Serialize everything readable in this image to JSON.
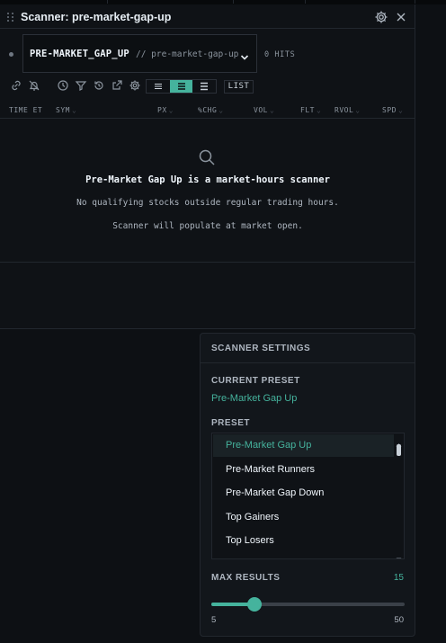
{
  "panel": {
    "title": "Scanner: pre-market-gap-up",
    "icons": {
      "settings": "gear-icon",
      "close": "close-icon",
      "drag": "grip-icon"
    }
  },
  "preset_chip": {
    "name": "PRE-MARKET_GAP_UP",
    "slug": "// pre-market-gap-up",
    "hits": "0 HITS"
  },
  "toolbar": {
    "icons": [
      "link-icon",
      "bell-off-icon",
      "clock-icon",
      "filter-icon",
      "history-icon",
      "external-link-icon",
      "gear-icon"
    ],
    "density_options": [
      "compact",
      "normal",
      "comfortable"
    ],
    "density_selected": "normal",
    "list_label": "LIST"
  },
  "columns": [
    {
      "label": "TIME ET"
    },
    {
      "label": "SYM"
    },
    {
      "label": "PX"
    },
    {
      "label": "%CHG"
    },
    {
      "label": "VOL"
    },
    {
      "label": "FLT"
    },
    {
      "label": "RVOL"
    },
    {
      "label": "SPD"
    }
  ],
  "empty_state": {
    "icon": "search-icon",
    "title": "Pre-Market Gap Up is a market-hours scanner",
    "line1": "No qualifying stocks outside regular trading hours.",
    "line2": "Scanner will populate at market open."
  },
  "settings": {
    "title": "SCANNER SETTINGS",
    "current_preset_label": "CURRENT PRESET",
    "current_preset_value": "Pre-Market Gap Up",
    "preset_label": "PRESET",
    "presets": [
      "Pre-Market Gap Up",
      "Pre-Market Runners",
      "Pre-Market Gap Down",
      "Top Gainers",
      "Top Losers"
    ],
    "selected_index": 0,
    "max_results_label": "MAX RESULTS",
    "max_results_value": "15",
    "slider_min": "5",
    "slider_max": "50",
    "slider_level": 15
  },
  "colors": {
    "accent": "#45b39d",
    "background": "#0d1014",
    "panel": "#0f1216"
  }
}
